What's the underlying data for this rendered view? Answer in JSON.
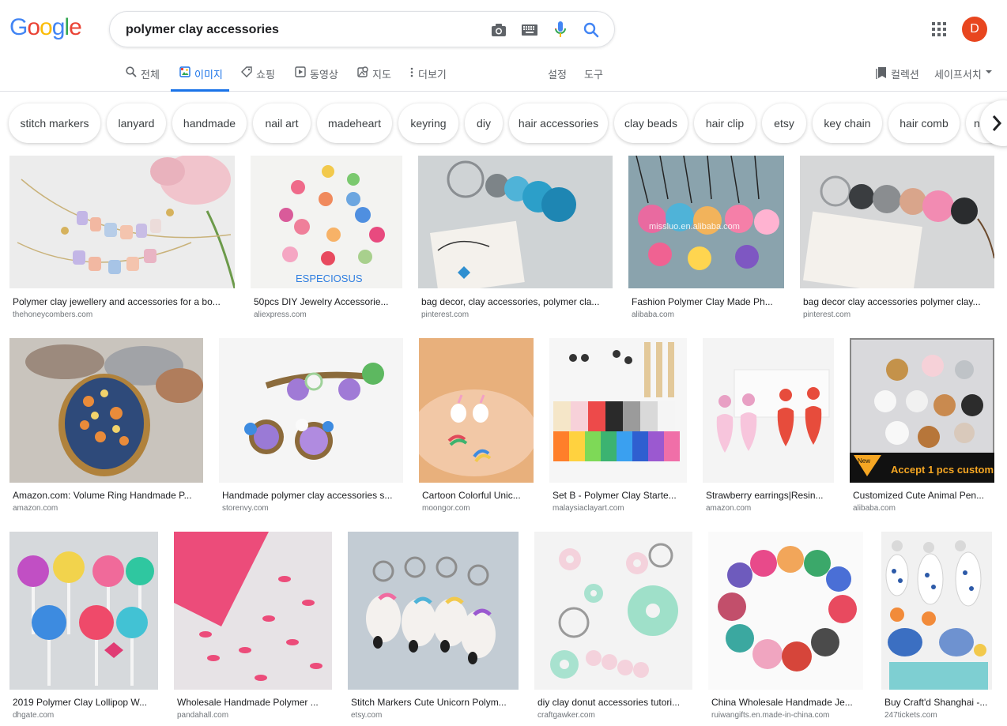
{
  "search": {
    "query": "polymer clay accessories"
  },
  "logo": [
    "G",
    "o",
    "o",
    "g",
    "l",
    "e"
  ],
  "logo_colors": [
    "#4285f4",
    "#ea4335",
    "#fbbc05",
    "#4285f4",
    "#34a853",
    "#ea4335"
  ],
  "account_initial": "D",
  "tabs": {
    "all": "전체",
    "images": "이미지",
    "shopping": "쇼핑",
    "videos": "동영상",
    "maps": "지도",
    "more": "더보기",
    "settings": "설정",
    "tools": "도구",
    "collections": "컬렉션",
    "safesearch": "세이프서치"
  },
  "chips": [
    "stitch markers",
    "lanyard",
    "handmade",
    "nail art",
    "madeheart",
    "keyring",
    "diy",
    "hair accessories",
    "clay beads",
    "hair clip",
    "etsy",
    "key chain",
    "hair comb",
    "n"
  ],
  "results": [
    {
      "title": "Polymer clay jewellery and accessories for a bo...",
      "source": "thehoneycombers.com"
    },
    {
      "title": "50pcs DIY Jewelry Accessorie...",
      "source": "aliexpress.com",
      "overlay": "ESPECIOSUS"
    },
    {
      "title": "bag decor, clay accessories, polymer cla...",
      "source": "pinterest.com"
    },
    {
      "title": "Fashion Polymer Clay Made Ph...",
      "source": "alibaba.com",
      "overlay": "missluo.en.alibaba.com"
    },
    {
      "title": "bag decor clay accessories polymer clay...",
      "source": "pinterest.com"
    },
    {
      "title": "Amazon.com: Volume Ring Handmade P...",
      "source": "amazon.com"
    },
    {
      "title": "Handmade polymer clay accessories s...",
      "source": "storenvy.com"
    },
    {
      "title": "Cartoon Colorful Unic...",
      "source": "moongor.com"
    },
    {
      "title": "Set B - Polymer Clay Starte...",
      "source": "malaysiaclayart.com"
    },
    {
      "title": "Strawberry earrings|Resin...",
      "source": "amazon.com"
    },
    {
      "title": "Customized Cute Animal Pen...",
      "source": "alibaba.com",
      "overlay": "Accept 1 pcs custom",
      "overlay2": "New"
    },
    {
      "title": "2019 Polymer Clay Lollipop W...",
      "source": "dhgate.com"
    },
    {
      "title": "Wholesale Handmade Polymer ...",
      "source": "pandahall.com"
    },
    {
      "title": "Stitch Markers Cute Unicorn Polym...",
      "source": "etsy.com"
    },
    {
      "title": "diy clay donut accessories tutori...",
      "source": "craftgawker.com"
    },
    {
      "title": "China Wholesale Handmade Je...",
      "source": "ruiwangifts.en.made-in-china.com"
    },
    {
      "title": "Buy Craft'd Shanghai -...",
      "source": "247tickets.com"
    }
  ],
  "colors": {
    "accent": "#1a73e8",
    "avatar": "#e8461f"
  }
}
